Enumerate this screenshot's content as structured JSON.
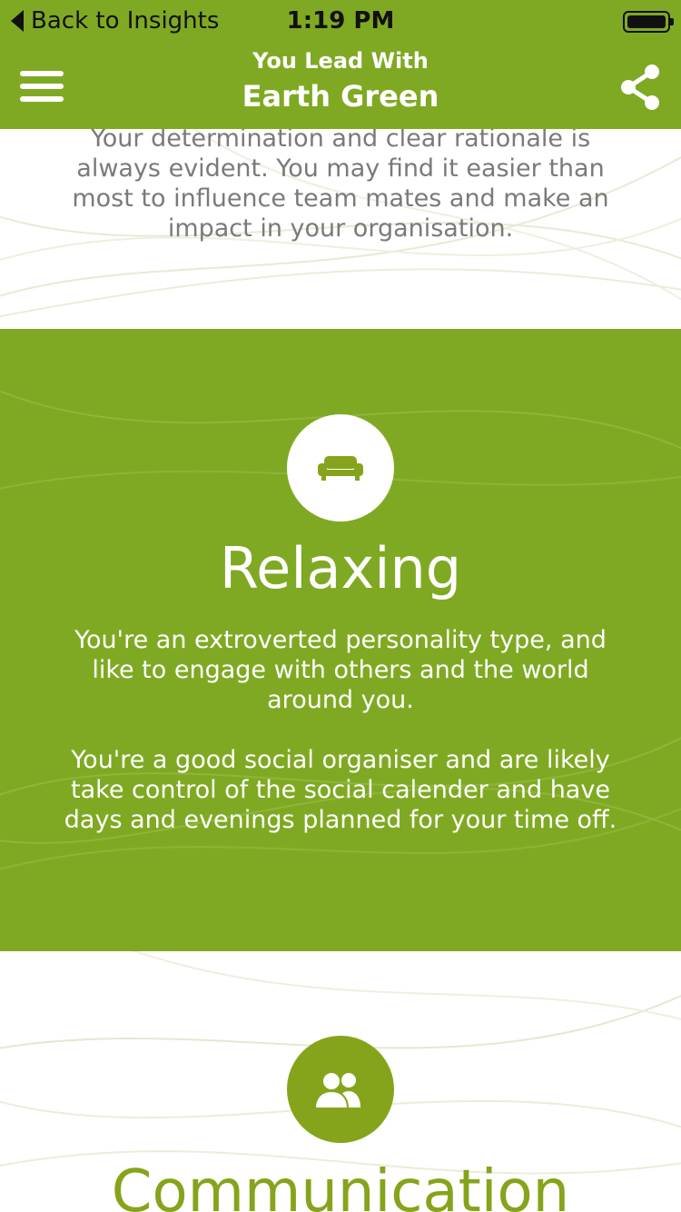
{
  "status_bar": {
    "back_label": "Back to Insights",
    "time": "1:19 PM"
  },
  "nav": {
    "subtitle": "You Lead With",
    "title": "Earth Green"
  },
  "sections": [
    {
      "text": "Your determination and clear rationale is always evident. You may find it easier than most to influence team mates and make an impact in your organisation."
    },
    {
      "icon": "sofa-icon",
      "title": "Relaxing",
      "paragraphs": [
        "You're an extroverted personality type, and like to engage with others and the world around you.",
        "You're a good social organiser and are likely take control of the social calender and have days and evenings planned for your time off."
      ]
    },
    {
      "icon": "people-icon",
      "title": "Communication"
    }
  ],
  "colors": {
    "brand_green": "#80a923",
    "icon_green": "#86a41b",
    "body_gray": "#7a7a7a"
  }
}
